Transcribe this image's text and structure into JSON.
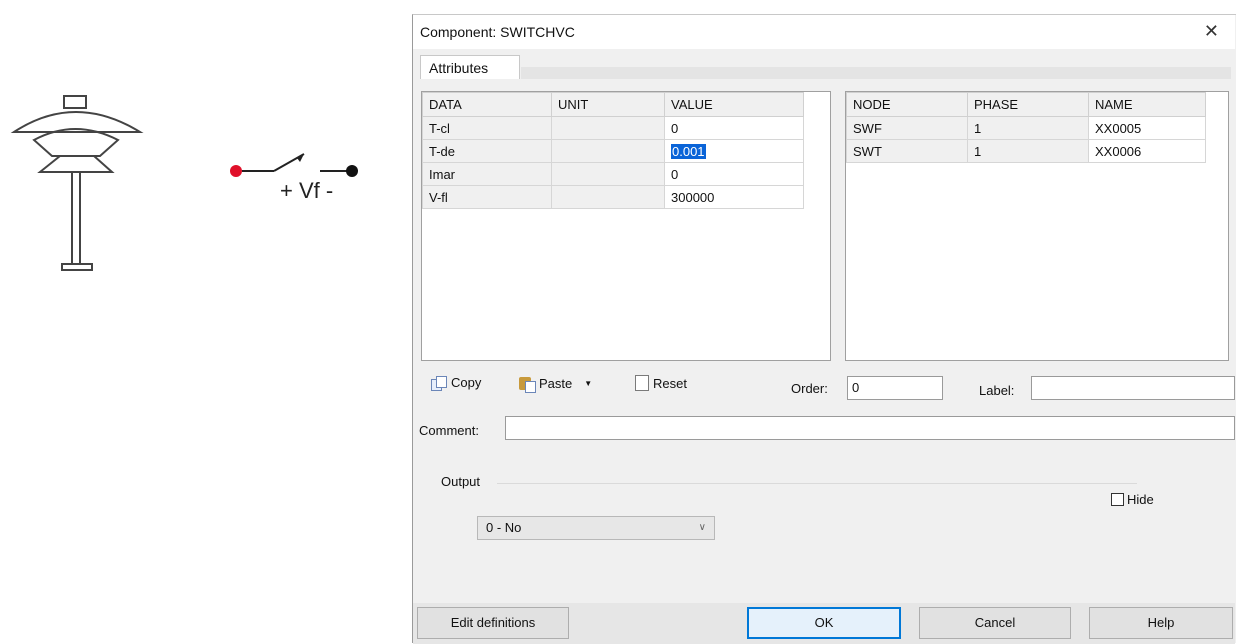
{
  "dialog": {
    "title": "Component: SWITCHVC",
    "close_glyph": "✕",
    "tab_label": "Attributes"
  },
  "schematic": {
    "switch_label": "+ Vf -",
    "icons": [
      "lamp-icon",
      "switch-symbol-icon"
    ]
  },
  "data_table": {
    "headers": [
      "DATA",
      "UNIT",
      "VALUE"
    ],
    "rows": [
      {
        "data": "T-cl",
        "unit": "",
        "value": "0"
      },
      {
        "data": "T-de",
        "unit": "",
        "value": "0.001"
      },
      {
        "data": "Imar",
        "unit": "",
        "value": "0"
      },
      {
        "data": "V-fl",
        "unit": "",
        "value": "300000"
      }
    ]
  },
  "node_table": {
    "headers": [
      "NODE",
      "PHASE",
      "NAME"
    ],
    "rows": [
      {
        "node": "SWF",
        "phase": "1",
        "name": "XX0005"
      },
      {
        "node": "SWT",
        "phase": "1",
        "name": "XX0006"
      }
    ]
  },
  "toolbar": {
    "copy_label": "Copy",
    "paste_label": "Paste",
    "dropdown_glyph": "▼",
    "reset_label": "Reset"
  },
  "fields": {
    "order_label": "Order:",
    "order_value": "0",
    "label_label": "Label:",
    "label_value": "",
    "comment_label": "Comment:",
    "comment_value": ""
  },
  "output": {
    "group_label": "Output",
    "selected": "0 - No",
    "chevron_glyph": "∨",
    "hide_label": "Hide",
    "hide_checked": false
  },
  "buttons": {
    "edit_definitions": "Edit definitions",
    "ok": "OK",
    "cancel": "Cancel",
    "help": "Help"
  },
  "colors": {
    "selection": "#0a64d8",
    "left_node": "#e0102a",
    "right_node": "#111111"
  }
}
